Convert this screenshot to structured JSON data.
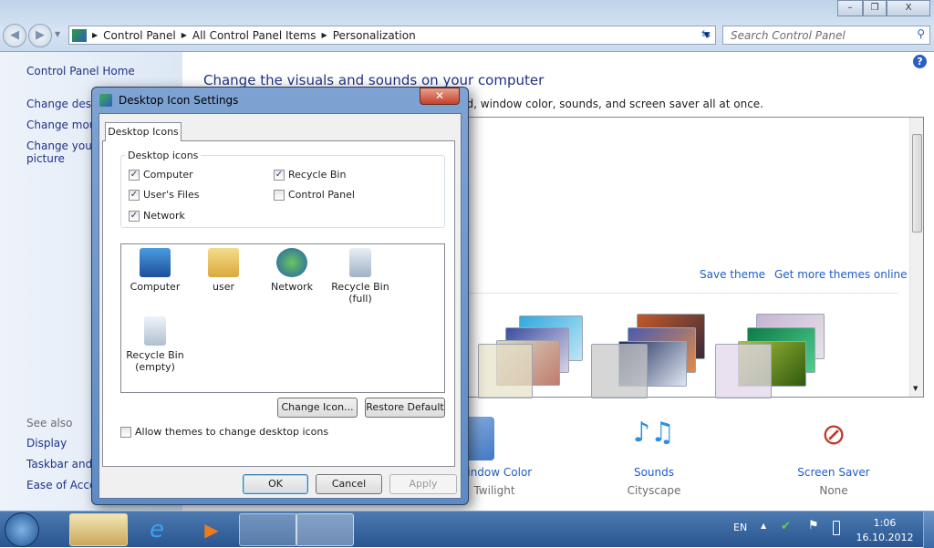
{
  "window": {
    "min": "–",
    "max": "❐",
    "close": "X"
  },
  "address": {
    "crumbs": [
      "Control Panel",
      "All Control Panel Items",
      "Personalization"
    ],
    "search_placeholder": "Search Control Panel"
  },
  "sidebar": {
    "home": "Control Panel Home",
    "links": [
      "Change desktop icons",
      "Change mouse pointers",
      "Change your account picture"
    ],
    "see_also": "See also",
    "see_links": [
      "Display",
      "Taskbar and Start Menu",
      "Ease of Access Center"
    ]
  },
  "main": {
    "title": "Change the visuals and sounds on your computer",
    "subtitle": "Click a theme to change the desktop background, window color, sounds, and screen saver all at once.",
    "save_theme": "Save theme",
    "get_more": "Get more themes online",
    "bottom": [
      {
        "label": "Window Color",
        "value": "Twilight"
      },
      {
        "label": "Sounds",
        "value": "Cityscape"
      },
      {
        "label": "Screen Saver",
        "value": "None"
      }
    ]
  },
  "dialog": {
    "title": "Desktop Icon Settings",
    "tab": "Desktop Icons",
    "group": "Desktop icons",
    "checkboxes": [
      {
        "label": "Computer",
        "checked": true
      },
      {
        "label": "User's Files",
        "checked": true
      },
      {
        "label": "Network",
        "checked": true
      },
      {
        "label": "Recycle Bin",
        "checked": true
      },
      {
        "label": "Control Panel",
        "checked": false
      }
    ],
    "icons": [
      {
        "name": "Computer"
      },
      {
        "name": "user"
      },
      {
        "name": "Network"
      },
      {
        "name": "Recycle Bin",
        "sub": "(full)"
      },
      {
        "name": "Recycle Bin",
        "sub": "(empty)"
      }
    ],
    "change_icon": "Change Icon...",
    "restore": "Restore Default",
    "allow_themes": "Allow themes to change desktop icons",
    "ok": "OK",
    "cancel": "Cancel",
    "apply": "Apply"
  },
  "taskbar": {
    "lang": "EN",
    "time": "1:06",
    "date": "16.10.2012"
  }
}
